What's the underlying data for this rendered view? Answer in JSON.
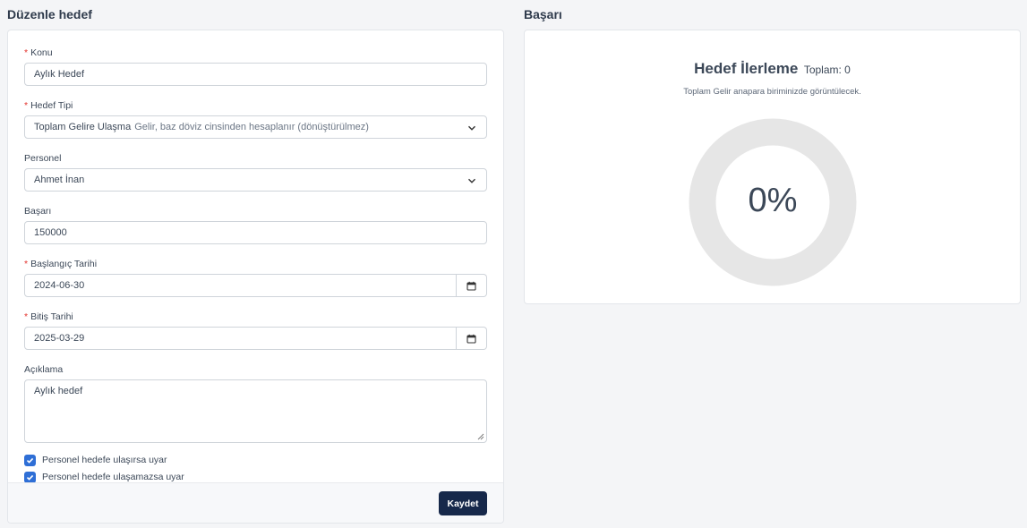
{
  "form": {
    "section_title": "Düzenle hedef",
    "fields": {
      "konu": {
        "label": "Konu",
        "value": "Aylık Hedef",
        "required": true
      },
      "hedef_tipi": {
        "label": "Hedef Tipi",
        "value": "Toplam Gelire Ulaşma",
        "hint": "Gelir, baz döviz cinsinden hesaplanır (dönüştürülmez)",
        "required": true
      },
      "personel": {
        "label": "Personel",
        "value": "Ahmet İnan"
      },
      "basari": {
        "label": "Başarı",
        "value": "150000"
      },
      "baslangic": {
        "label": "Başlangıç Tarihi",
        "value": "2024-06-30",
        "required": true
      },
      "bitis": {
        "label": "Bitiş Tarihi",
        "value": "2025-03-29",
        "required": true
      },
      "aciklama": {
        "label": "Açıklama",
        "value": "Aylık hedef"
      }
    },
    "checkboxes": [
      {
        "label": "Personel hedefe ulaşırsa uyar",
        "checked": true
      },
      {
        "label": "Personel hedefe ulaşamazsa uyar",
        "checked": true
      }
    ],
    "required_marker": "*",
    "save_label": "Kaydet"
  },
  "progress": {
    "section_title": "Başarı",
    "title": "Hedef İlerleme",
    "total": "Toplam: 0",
    "subtitle": "Toplam Gelir anapara biriminizde görüntülecek.",
    "percent_label": "0%",
    "percent_value": 0
  },
  "colors": {
    "accent": "#2f6fd6",
    "button": "#16284a",
    "required": "#e3342f",
    "ring": "#e6e6e6"
  }
}
